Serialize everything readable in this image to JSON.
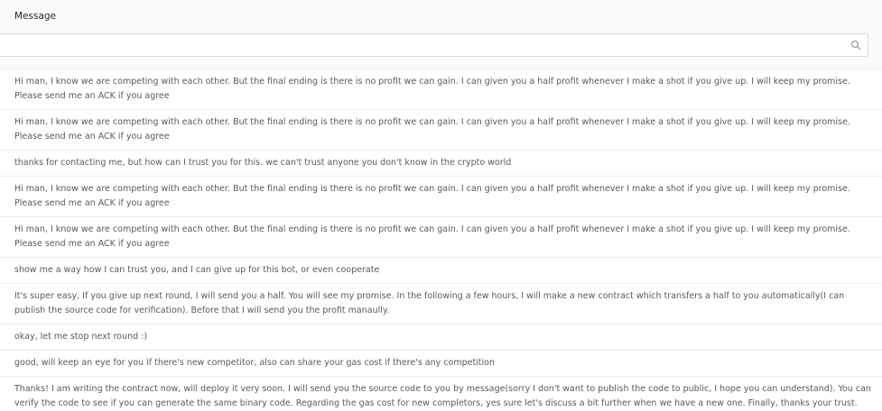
{
  "table": {
    "column_header": "Message",
    "search": {
      "value": "",
      "placeholder": ""
    },
    "rows": [
      "Hi man, I know we are competing with each other. But the final ending is there is no profit we can gain. I can given you a half profit whenever I make a shot if you give up. I will keep my promise. Please send me an ACK if you agree",
      "Hi man, I know we are competing with each other. But the final ending is there is no profit we can gain. I can given you a half profit whenever I make a shot if you give up. I will keep my promise. Please send me an ACK if you agree",
      "thanks for contacting me, but how can I trust you for this. we can't trust anyone you don't know in the crypto world",
      "Hi man, I know we are competing with each other. But the final ending is there is no profit we can gain. I can given you a half profit whenever I make a shot if you give up. I will keep my promise. Please send me an ACK if you agree",
      "Hi man, I know we are competing with each other. But the final ending is there is no profit we can gain. I can given you a half profit whenever I make a shot if you give up. I will keep my promise. Please send me an ACK if you agree",
      "show me a way how I can trust you, and I can give up for this bot, or even cooperate",
      "It's super easy, If you give up next round, I will send you a half. You will see my promise. In the following a few hours, I will make a new contract which transfers a half to you automatically(I can publish the source code for verification). Before that I will send you the profit manaully.",
      "okay, let me stop next round :)",
      "good, will keep an eye for you if there's new competitor, also can share your gas cost if there's any competition",
      "Thanks! I am writing the contract now, will deploy it very soon. I will send you the source code to you by message(sorry I don't want to publish the code to public, I hope you can understand). You can verify the code to see if you can generate the same binary code. Regarding the gas cost for new completors, yes sure let's discuss a bit further when we have a new one. Finally, thanks your trust."
    ]
  }
}
